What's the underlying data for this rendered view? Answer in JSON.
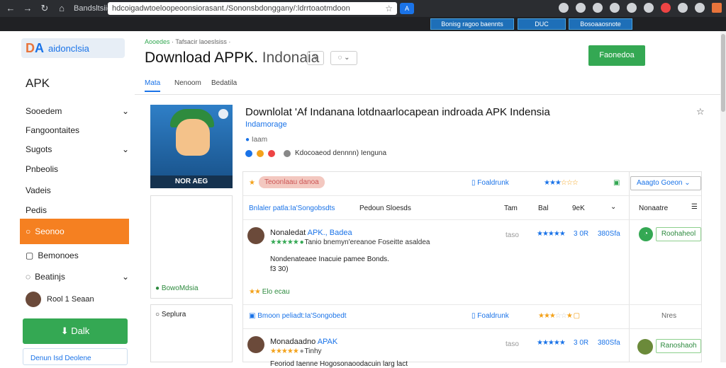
{
  "browser": {
    "tab_title": "Bandsltsiiosa",
    "url": "hdcoigadwtoeloopeoonsiorasant./Sononsbdonggany/:ldrrtoaotmdoon",
    "ext_label": "A"
  },
  "toolbar2": {
    "btn1": "Bonisg ragoo baennts",
    "btn2": "DUC",
    "btn3": "Bosoaaosnote"
  },
  "sidebar": {
    "logo_text": "aidonclsia",
    "apk_label": "APK",
    "items": [
      {
        "label": "Sooedem",
        "chevron": "⌄"
      },
      {
        "label": "Fangoontaites",
        "chevron": ""
      },
      {
        "label": "Sugots",
        "chevron": "⌄"
      },
      {
        "label": "Pnbeolis",
        "chevron": ""
      },
      {
        "label": "Vadeis",
        "chevron": ""
      },
      {
        "label": "Pedis",
        "chevron": ""
      }
    ],
    "active_item": "Seonoo",
    "item_bottom1": "Bemonoes",
    "item_bottom2": "Beatinjs",
    "user_name": "Rool 1 Seaan",
    "download_label": "Dalk",
    "link_label": "Denun Isd Deolene"
  },
  "main": {
    "breadcrumb_a": "Aooedes",
    "breadcrumb_b": "· Tafsacir laoeslsiss ·",
    "title": "Download APPK.",
    "title_light": "Indonaia",
    "top_button": "Faonedoa",
    "tabs": [
      "Mata",
      "Nenoom",
      "Bedatila"
    ],
    "app_caption": "NOR AEG",
    "heading": "Downlolat 'Af Indanana lotdnaarlocapean indroada APK Indensia",
    "subheading": "Indamorage",
    "meta_text": "Kdocoaeod dennnn) Ienguna",
    "side_box1": "BowoMdsia",
    "side_box2": "Seplura",
    "filter_label": "Teoonlaau danoa",
    "toggle1": "Foaldrunk",
    "select1": "Aaagto Goeon",
    "hdr": {
      "col1": "Bnlaler patla:Ia'Songobsdts",
      "col2": "Pedoun Sloesds",
      "col3": "Tam",
      "col4": "Bal",
      "col5": "9eK",
      "col6": "Nonaatre"
    },
    "app1": {
      "name": "Nonaledat",
      "name_blue": "APK., Badea",
      "desc": "Tanio bnemyn'ereanoe Foseitte asaldea",
      "line2": "Nondenateaee Inacuie pamee Bonds.",
      "line3": "f3 30)",
      "dl_col1": "taso",
      "dl_col2": "3 0R",
      "dl_col3": "380Sfa",
      "btn": "Roohaheol",
      "footer": "Elo ecau"
    },
    "row2": {
      "label": "Bmoon peliadt:Ia'Songobedt",
      "toggle": "Foaldrunk",
      "right": "Nres"
    },
    "app2": {
      "name": "Monadaadno",
      "name_blue": "APAK",
      "desc": "Tinhy",
      "line2": "Feoriod Iaenne Hogosonaoodacuin larg lact",
      "dl_col1": "taso",
      "dl_col2": "3 0R",
      "dl_col3": "380Sfa",
      "btn": "Ranoshaoh"
    }
  }
}
